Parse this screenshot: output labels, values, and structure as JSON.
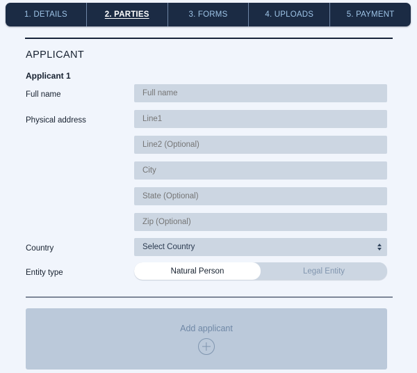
{
  "tabs": [
    {
      "label": "1. DETAILS",
      "active": false
    },
    {
      "label": "2. PARTIES",
      "active": true
    },
    {
      "label": "3. FORMS",
      "active": false
    },
    {
      "label": "4. UPLOADS",
      "active": false
    },
    {
      "label": "5. PAYMENT",
      "active": false
    }
  ],
  "section": {
    "title": "APPLICANT",
    "applicant_label": "Applicant 1"
  },
  "fields": {
    "full_name": {
      "label": "Full name",
      "placeholder": "Full name",
      "value": ""
    },
    "physical_address": {
      "label": "Physical address",
      "lines": [
        {
          "placeholder": "Line1",
          "value": ""
        },
        {
          "placeholder": "Line2 (Optional)",
          "value": ""
        },
        {
          "placeholder": "City",
          "value": ""
        },
        {
          "placeholder": "State (Optional)",
          "value": ""
        },
        {
          "placeholder": "Zip (Optional)",
          "value": ""
        }
      ]
    },
    "country": {
      "label": "Country",
      "selected": "Select Country"
    },
    "entity_type": {
      "label": "Entity type",
      "options": [
        {
          "label": "Natural Person",
          "selected": true
        },
        {
          "label": "Legal Entity",
          "selected": false
        }
      ]
    }
  },
  "add_applicant": {
    "label": "Add applicant",
    "icon": "plus-circle-icon"
  },
  "colors": {
    "page_background": "#f1f5fc",
    "tabbar_background": "#1b2b44",
    "tab_inactive_text": "#9dc3e6",
    "tab_active_text": "#ffffff",
    "input_background": "#ccd6e2",
    "placeholder_text": "#8fa2b8",
    "panel_background": "#bbc9da",
    "divider_top": "#17243a",
    "divider_bottom": "#7d8798"
  }
}
